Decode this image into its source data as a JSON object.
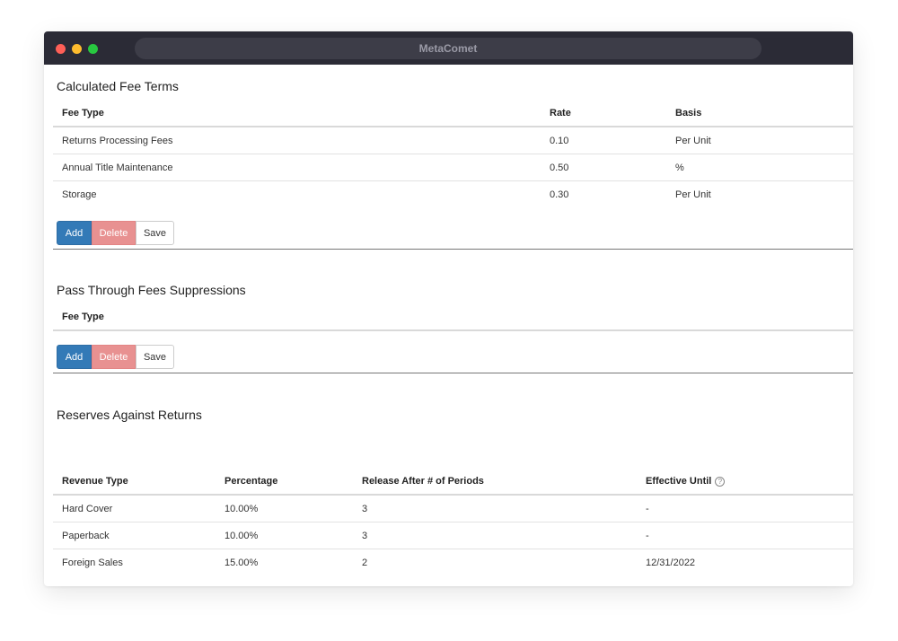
{
  "window": {
    "title": "MetaComet"
  },
  "fee_terms": {
    "title": "Calculated Fee Terms",
    "columns": [
      "Fee Type",
      "Rate",
      "Basis"
    ],
    "rows": [
      [
        "Returns Processing Fees",
        "0.10",
        "Per Unit"
      ],
      [
        "Annual Title Maintenance",
        "0.50",
        "%"
      ],
      [
        "Storage",
        "0.30",
        "Per Unit"
      ]
    ]
  },
  "suppressions": {
    "title": "Pass Through Fees Suppressions",
    "columns": [
      "Fee Type"
    ]
  },
  "reserves": {
    "title": "Reserves Against Returns",
    "columns": [
      "Revenue Type",
      "Percentage",
      "Release After # of Periods",
      "Effective Until"
    ],
    "rows": [
      [
        "Hard Cover",
        "10.00%",
        "3",
        "-"
      ],
      [
        "Paperback",
        "10.00%",
        "3",
        "-"
      ],
      [
        "Foreign Sales",
        "15.00%",
        "2",
        "12/31/2022"
      ]
    ]
  },
  "buttons": {
    "add": "Add",
    "delete": "Delete",
    "save": "Save"
  },
  "icons": {
    "help": "question-circle"
  },
  "colors": {
    "add": "#337ab7",
    "delete": "#e89191",
    "titlebar": "#2b2b36"
  }
}
